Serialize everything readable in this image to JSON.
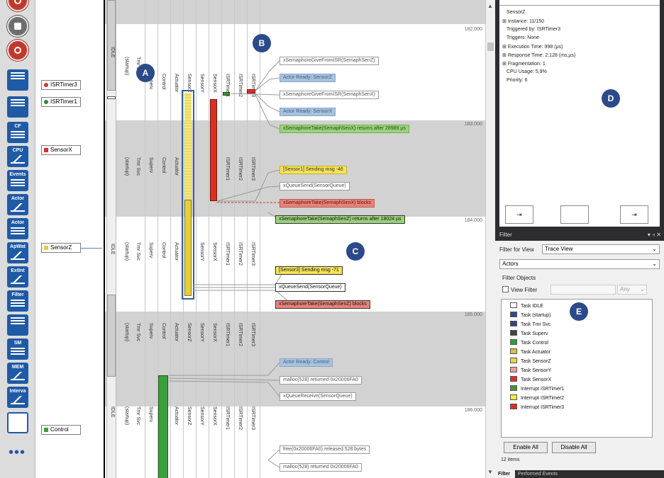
{
  "toolbar": {
    "buttons": [
      {
        "name": "record",
        "label": ""
      },
      {
        "name": "stop",
        "label": ""
      },
      {
        "name": "camera",
        "label": ""
      },
      {
        "name": "dashboard",
        "label": ""
      },
      {
        "name": "trace-view",
        "label": ""
      },
      {
        "name": "cpu-load-flow",
        "label": "CF"
      },
      {
        "name": "cpu-load",
        "label": "CPU"
      },
      {
        "name": "events",
        "label": "Events"
      },
      {
        "name": "actor-graph",
        "label": "Actor"
      },
      {
        "name": "actor-list",
        "label": "Actor"
      },
      {
        "name": "app-watch",
        "label": "ApWat"
      },
      {
        "name": "extint",
        "label": "ExtInt"
      },
      {
        "name": "filter",
        "label": "Filter"
      },
      {
        "name": "instances",
        "label": ""
      },
      {
        "name": "state-machines",
        "label": "SM"
      },
      {
        "name": "memory",
        "label": "MEM"
      },
      {
        "name": "intervals",
        "label": "Interva"
      },
      {
        "name": "blank",
        "label": ""
      }
    ],
    "more": "•••"
  },
  "actor_labels": [
    {
      "text": "ISRTimer3",
      "color": "#d93025"
    },
    {
      "text": "ISRTimer1",
      "color": "#2e8b2e"
    },
    {
      "text": "SensorX",
      "color": "#d93025"
    },
    {
      "text": "SensorZ",
      "color": "#e5cf3a"
    },
    {
      "text": "Control",
      "color": "#3aa03a"
    }
  ],
  "trace": {
    "columns": [
      "IDLE",
      "(startup)",
      "Tmr Svc",
      "Superv",
      "Control",
      "Actuator",
      "SensorZ",
      "SensorY",
      "SensorX",
      "ISRTimer1",
      "ISRTimer2",
      "ISRTimer3"
    ],
    "ticks": [
      "182.000",
      "183.000",
      "184.000",
      "185.000",
      "186.000"
    ],
    "events": [
      {
        "text": "xSemaphoreGiveFromISR(SemaphSenZ)",
        "style": "white"
      },
      {
        "text": "Actor Ready: SensorZ",
        "style": "blue"
      },
      {
        "text": "xSemaphoreGiveFromISR(SemaphSenX)",
        "style": "white"
      },
      {
        "text": "Actor Ready: SensorX",
        "style": "blue"
      },
      {
        "text": "xSemaphoreTake(SemaphSenX) returns after 28989 µs",
        "style": "green"
      },
      {
        "text": "[Sensor1] Sending msg -46",
        "style": "yellow"
      },
      {
        "text": "xQueueSend(SensorQueue)",
        "style": "white"
      },
      {
        "text": "xSemaphoreTake(SemaphSenX) blocks",
        "style": "red"
      },
      {
        "text": "xSemaphoreTake(SemaphSenZ) returns after 18024 µs",
        "style": "green"
      },
      {
        "text": "[Sensor3] Sending msg -71",
        "style": "yellow"
      },
      {
        "text": "xQueueSend(SensorQueue)",
        "style": "white"
      },
      {
        "text": "xSemaphoreTake(SemaphSenZ) blocks",
        "style": "red"
      },
      {
        "text": "Actor Ready: Control",
        "style": "blue"
      },
      {
        "text": "malloc(528) returned 0x20006FA0",
        "style": "white"
      },
      {
        "text": "xQueueReceive(SensorQueue)",
        "style": "white"
      },
      {
        "text": "free(0x20006FA0) released 528 bytes",
        "style": "white"
      },
      {
        "text": "malloc(528) returned 0x20006FA0",
        "style": "white"
      }
    ],
    "callouts": [
      "A",
      "B",
      "C"
    ]
  },
  "details": {
    "lines": [
      "SensorZ",
      "Instance: 11/150",
      "Triggered by: ISRTimer3",
      "Triggers: None",
      "Execution Time: 998 (µs)",
      "Response Time: 2.128 (ms,µs)",
      "Fragmentation: 1",
      "CPU Usage: 5,9%",
      "Priority: 6"
    ],
    "callout": "D"
  },
  "filter": {
    "title": "Filter",
    "title_controls": "▾ ⫞ ✕",
    "filter_for_view_label": "Filter for View",
    "filter_for_view_value": "Trace View",
    "category_value": "Actors",
    "filter_objects_label": "Filter Objects",
    "view_filter_label": "View Filter",
    "any_label": "Any",
    "items": [
      {
        "text": "Task IDLE",
        "color": "#ffffff"
      },
      {
        "text": "Task (startup)",
        "color": "#2e4a8f"
      },
      {
        "text": "Task Tmr Svc",
        "color": "#3b3b8a"
      },
      {
        "text": "Task Superv",
        "color": "#444444"
      },
      {
        "text": "Task Control",
        "color": "#2f9e3a"
      },
      {
        "text": "Task Actuator",
        "color": "#d4c13a"
      },
      {
        "text": "Task SensorZ",
        "color": "#e8d64a"
      },
      {
        "text": "Task SensorY",
        "color": "#e8a0a0"
      },
      {
        "text": "Task SensorX",
        "color": "#d93025"
      },
      {
        "text": "Interrupt ISRTimer1",
        "color": "#4f8f3a"
      },
      {
        "text": "Interrupt ISRTimer2",
        "color": "#f0e84a"
      },
      {
        "text": "Interrupt ISRTimer3",
        "color": "#d93025"
      }
    ],
    "callout": "E",
    "enable_all": "Enable All",
    "disable_all": "Disable All",
    "count": "12 items",
    "tabs": [
      "Filter",
      "Performed Events"
    ]
  }
}
